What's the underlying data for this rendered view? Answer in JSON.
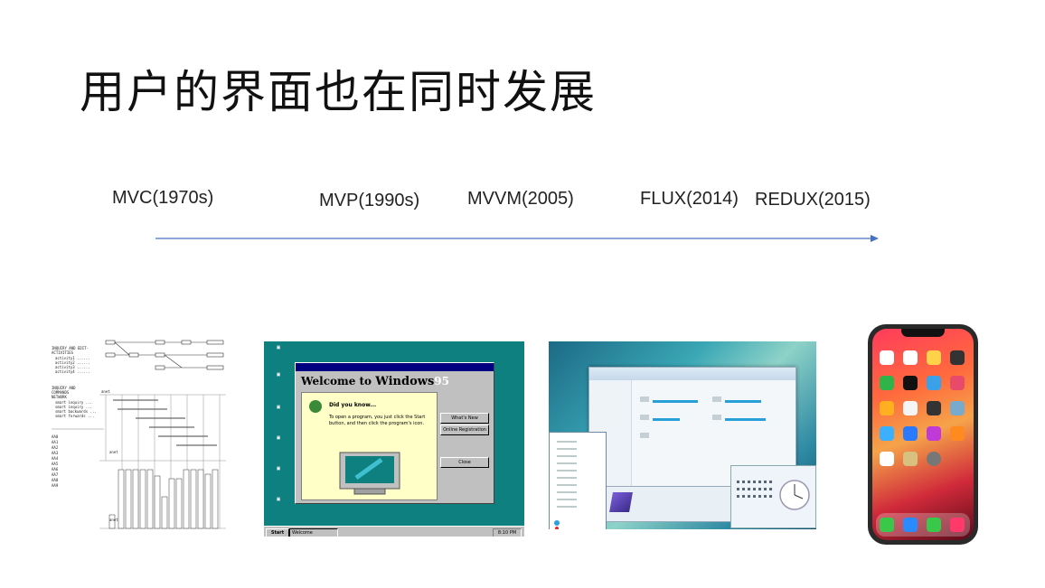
{
  "slide": {
    "title": "用户的界面也在同时发展"
  },
  "timeline": {
    "eras": [
      {
        "label": "MVC(1970s)"
      },
      {
        "label": "MVP(1990s)"
      },
      {
        "label": "MVVM(2005)"
      },
      {
        "label": "FLUX(2014)"
      },
      {
        "label": "REDUX(2015)"
      }
    ],
    "arrow_color": "#4472c4"
  },
  "images": {
    "mvc": {
      "alt": "1970s MVC printout"
    },
    "win95": {
      "dialog_heading_1": "Welcome to ",
      "dialog_heading_2": "Windows",
      "dialog_heading_3": "95",
      "did_you_know": "Did you know...",
      "tip": "To open a program, you just click the Start button, and then click the program's icon.",
      "whats_new": "What's New",
      "online_registration": "Online Registration",
      "close": "Close",
      "start": "Start",
      "task": "Welcome",
      "clock": "8:10 PM"
    },
    "win7": {
      "alt": "Windows 7 desktop"
    },
    "iphone": {
      "alt": "iPhone X home screen"
    }
  }
}
